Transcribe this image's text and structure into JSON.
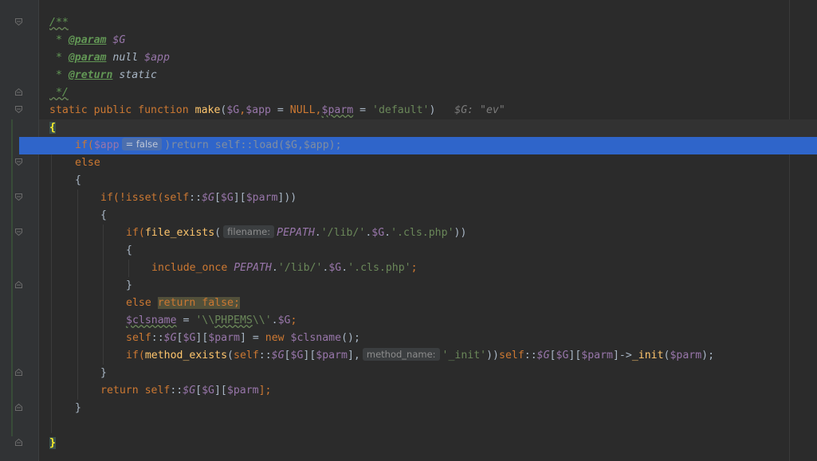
{
  "editor": {
    "lines": {
      "l1": "/**",
      "l2_star": " * ",
      "l2_tag": "@param",
      "l2_var": "$G",
      "l3_star": " * ",
      "l3_tag": "@param",
      "l3_type": "null",
      "l3_var": "$app",
      "l4_star": " * ",
      "l4_tag": "@return",
      "l4_type": "static",
      "l5": " */",
      "l6_static": "static public function",
      "l6_fn": "make",
      "l6_open": "(",
      "l6_g": "$G",
      "l6_comma1": ",",
      "l6_app": "$app",
      "l6_eq1": " = ",
      "l6_null": "NULL",
      "l6_comma2": ",",
      "l6_parm": "$parm",
      "l6_eq2": " = ",
      "l6_default": "'default'",
      "l6_close": ")",
      "l6_inline": "$G: \"ev\"",
      "l7_brace": "{",
      "l8_if": "if(",
      "l8_app": "$app",
      "l8_hint": "= false",
      "l8_rest": ")return self::load($G,$app);",
      "l9_else": "else",
      "l10_brace": "{",
      "l11_if": "if(!isset(",
      "l11_self": "self",
      "l11_colons": "::",
      "l11_g": "$G",
      "l11_b1": "[",
      "l11_g2": "$G",
      "l11_b2": "][",
      "l11_parm": "$parm",
      "l11_end": "]))",
      "l12_brace": "{",
      "l13_if": "if(",
      "l13_fn": "file_exists",
      "l13_open": "(",
      "l13_hint": "filename:",
      "l13_const": "PEPATH",
      "l13_dot1": ".",
      "l13_str1": "'/lib/'",
      "l13_dot2": ".",
      "l13_g": "$G",
      "l13_dot3": ".",
      "l13_str2": "'.cls.php'",
      "l13_close": "))",
      "l14_brace": "{",
      "l15_kw": "include_once",
      "l15_const": "PEPATH",
      "l15_dot1": ".",
      "l15_str1": "'/lib/'",
      "l15_dot2": ".",
      "l15_g": "$G",
      "l15_dot3": ".",
      "l15_str2": "'.cls.php'",
      "l15_semi": ";",
      "l16_brace": "}",
      "l17_else": "else",
      "l17_ret": "return false;",
      "l18_var": "$clsname",
      "l18_eq": " = ",
      "l18_str_a": "'\\\\",
      "l18_str_b": "PHPEMS",
      "l18_str_c": "\\\\'",
      "l18_dot": ".",
      "l18_g": "$G",
      "l18_semi": ";",
      "l19_self": "self",
      "l19_colons": "::",
      "l19_g": "$G",
      "l19_b1": "[",
      "l19_g2": "$G",
      "l19_b2": "][",
      "l19_parm": "$parm",
      "l19_b3": "]",
      "l19_eq": " = ",
      "l19_new": "new",
      "l19_cls": "$clsname",
      "l19_end": "();",
      "l20_if": "if(",
      "l20_fn": "method_exists",
      "l20_open": "(",
      "l20_self": "self",
      "l20_colons": "::",
      "l20_g": "$G",
      "l20_b1": "[",
      "l20_g2": "$G",
      "l20_b2": "][",
      "l20_parm": "$parm",
      "l20_b3": "],",
      "l20_hint": "method_name:",
      "l20_str": "'_init'",
      "l20_close": "))",
      "l20_self2": "self",
      "l20_colons2": "::",
      "l20_g3": "$G",
      "l20_b4": "[",
      "l20_g4": "$G",
      "l20_b5": "][",
      "l20_parm2": "$parm",
      "l20_arrow": "]->",
      "l20_init": "_init",
      "l20_p": "(",
      "l20_parm3": "$parm",
      "l20_end": ");",
      "l21_brace": "}",
      "l22_ret": "return",
      "l22_self": "self",
      "l22_colons": "::",
      "l22_g": "$G",
      "l22_b1": "[",
      "l22_g2": "$G",
      "l22_b2": "][",
      "l22_parm": "$parm",
      "l22_end": "];",
      "l23_brace": "}",
      "l25_brace": "}"
    }
  },
  "colors": {
    "background": "#2b2b2b",
    "keyword": "#cc7832",
    "variable": "#9876aa",
    "function": "#ffc66d",
    "string": "#6a8759",
    "doc": "#629755",
    "selection": "#2f65ca"
  }
}
